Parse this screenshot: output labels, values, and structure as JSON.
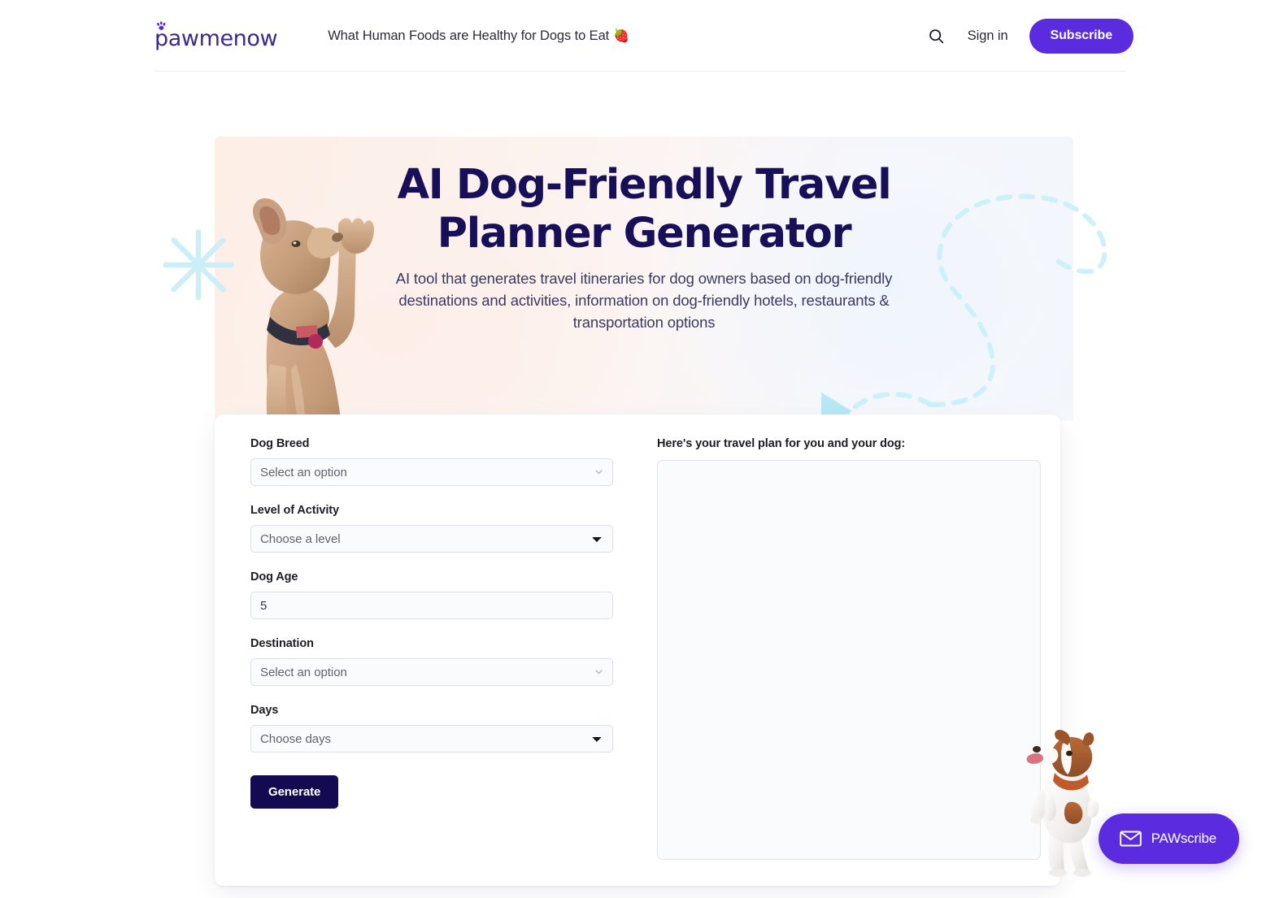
{
  "header": {
    "logo_text": "pawmenow",
    "logo_icon": "paw-print-icon",
    "nav_link": "What Human Foods are Healthy for Dogs to Eat",
    "nav_link_emoji": "🍓",
    "search_icon": "search-icon",
    "signin_label": "Sign in",
    "subscribe_label": "Subscribe",
    "accent_color": "#5b2be0"
  },
  "hero": {
    "title_line1": "AI Dog-Friendly Travel",
    "title_line2": "Planner Generator",
    "title_color": "#170f57",
    "subtitle": "AI tool that generates travel itineraries for dog owners based on dog-friendly destinations and activities, information on dog-friendly hotels, restaurants & transportation options",
    "decor_starburst": "starburst-icon",
    "decor_dashed_path": "dashed-route-icon",
    "dog_image": "dog-raising-paw-image"
  },
  "form": {
    "fields": [
      {
        "label": "Dog Breed",
        "type": "combobox",
        "value": "Select an option",
        "placeholder": "Select an option"
      },
      {
        "label": "Level of Activity",
        "type": "select",
        "value": "Choose a level",
        "options": [
          "Choose a level"
        ]
      },
      {
        "label": "Dog Age",
        "type": "text",
        "value": "5",
        "placeholder": "Dog Age"
      },
      {
        "label": "Destination",
        "type": "combobox",
        "value": "Select an option",
        "placeholder": "Select an option"
      },
      {
        "label": "Days",
        "type": "select",
        "value": "Choose days",
        "options": [
          "Choose days"
        ]
      }
    ],
    "submit_label": "Generate",
    "submit_color": "#140a52"
  },
  "output": {
    "label": "Here's your travel plan for you and your dog:",
    "value": "",
    "placeholder": ""
  },
  "card_dog_image": "jack-russell-standing-image",
  "widget": {
    "label": "PAWscribe",
    "icon": "envelope-icon",
    "color": "#5b2be0"
  }
}
